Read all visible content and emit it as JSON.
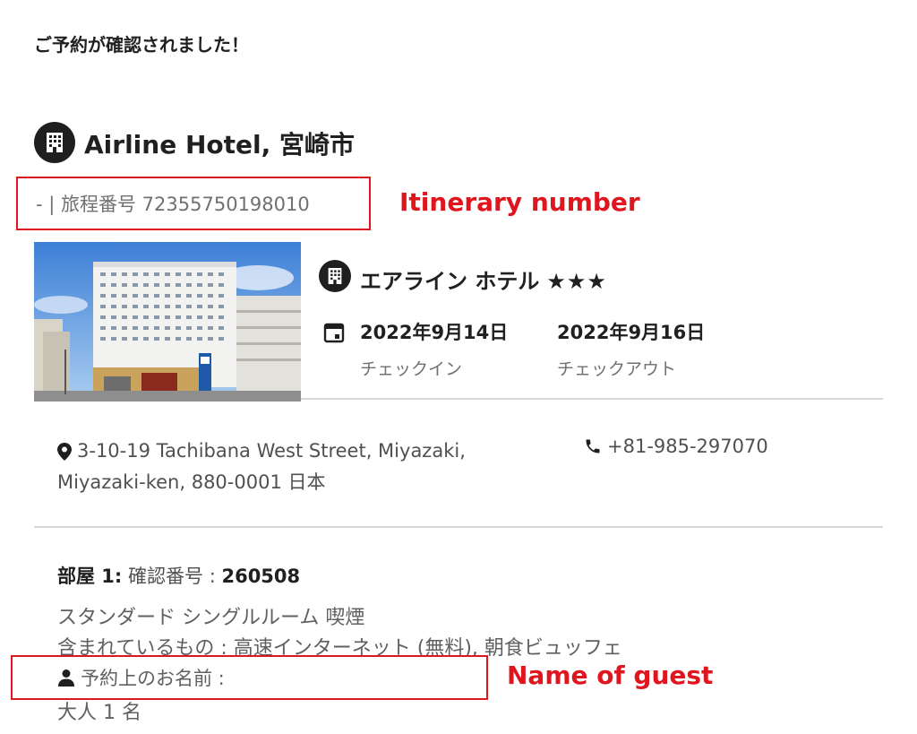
{
  "confirmation_heading": "ご予約が確認されました！",
  "hotel": {
    "title": "Airline Hotel, 宮崎市",
    "itinerary_text": "- | 旅程番号 72355750198010",
    "name": "エアライン ホテル",
    "stars_text": "★★★",
    "star_rating": 3,
    "checkin_date": "2022年9月14日",
    "checkin_label": "チェックイン",
    "checkout_date": "2022年9月16日",
    "checkout_label": "チェックアウト",
    "address_line1": "3-10-19 Tachibana West Street, Miyazaki,",
    "address_line2": "Miyazaki-ken, 880-0001 日本",
    "phone": "+81-985-297070"
  },
  "room": {
    "label": "部屋 1:",
    "confirm_label": "確認番号 :",
    "confirm_number": "260508",
    "room_type": "スタンダード シングルルーム 喫煙",
    "included": "含まれているもの : 高速インターネット (無料), 朝食ビュッフェ",
    "guest_label": "予約上のお名前 :",
    "occupancy": "大人 1 名"
  },
  "annotations": {
    "itinerary": "Itinerary number",
    "guest": "Name of guest",
    "color": "#e0161e"
  },
  "icons": [
    "building-icon",
    "calendar-icon",
    "map-pin-icon",
    "phone-icon",
    "person-icon"
  ]
}
